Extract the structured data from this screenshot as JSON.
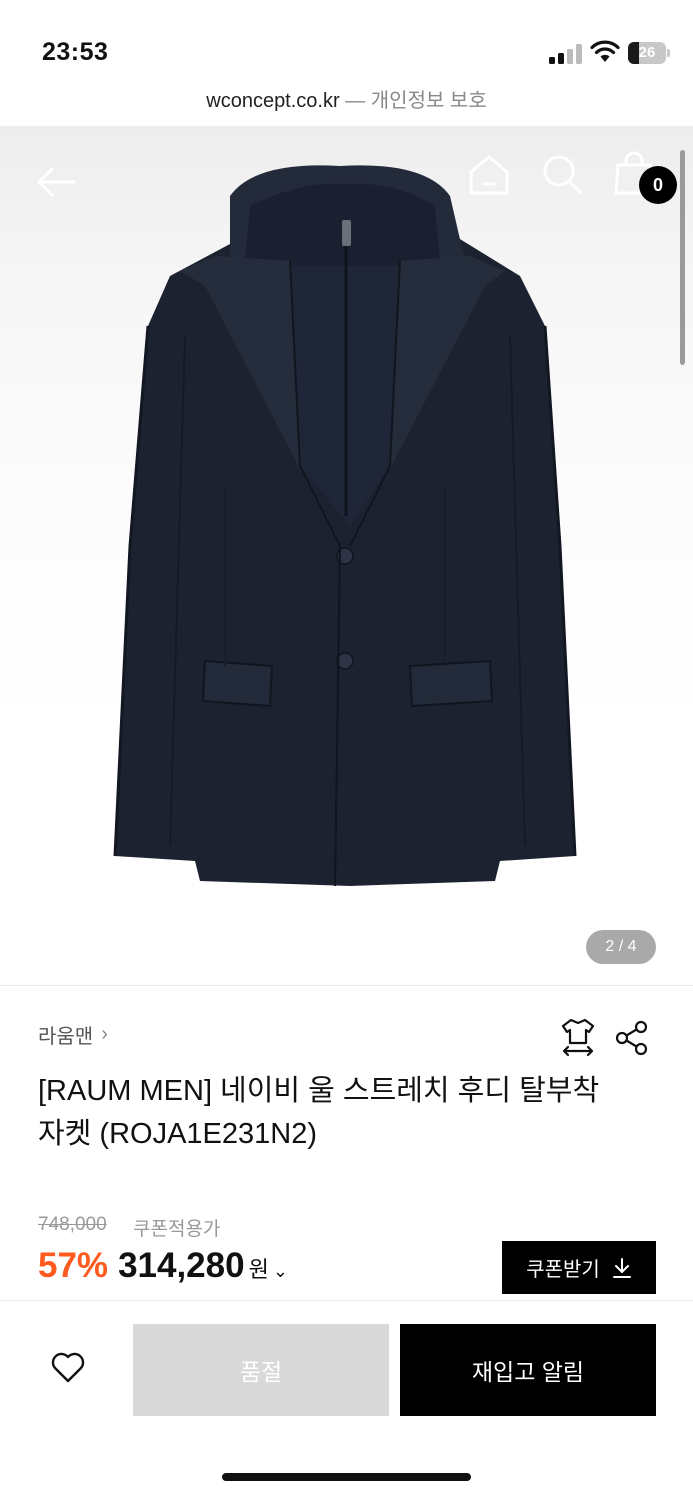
{
  "status_bar": {
    "time": "23:53",
    "battery_level": "26",
    "signal_icon": "signal-bars-icon",
    "wifi_icon": "wifi-icon"
  },
  "url_bar": {
    "domain": "wconcept.co.kr",
    "separator": "—",
    "privacy_label": "개인정보 보호"
  },
  "hero": {
    "back_icon": "back-arrow-icon",
    "home_icon": "home-icon",
    "search_icon": "search-icon",
    "cart_icon": "shopping-bag-icon",
    "cart_count": "0",
    "page_indicator": "2 / 4",
    "product_image": "navy hooded blazer jacket"
  },
  "product": {
    "brand": "라움맨",
    "brand_chevron": "›",
    "size_icon": "size-guide-shirt-icon",
    "share_icon": "share-icon",
    "title_line1": "[RAUM MEN] 네이비 울 스트레치 후디 탈부착",
    "title_line2": "자켓 (ROJA1E231N2)"
  },
  "price": {
    "original": "748,000",
    "coupon_note": "쿠폰적용가",
    "discount": "57%",
    "final": "314,280",
    "unit": "원",
    "chevron": "⌄",
    "coupon_button": "쿠폰받기",
    "discount_color": "#ff5a1f"
  },
  "actions": {
    "wish_icon": "heart-icon",
    "soldout_label": "품절",
    "restock_label": "재입고 알림"
  }
}
